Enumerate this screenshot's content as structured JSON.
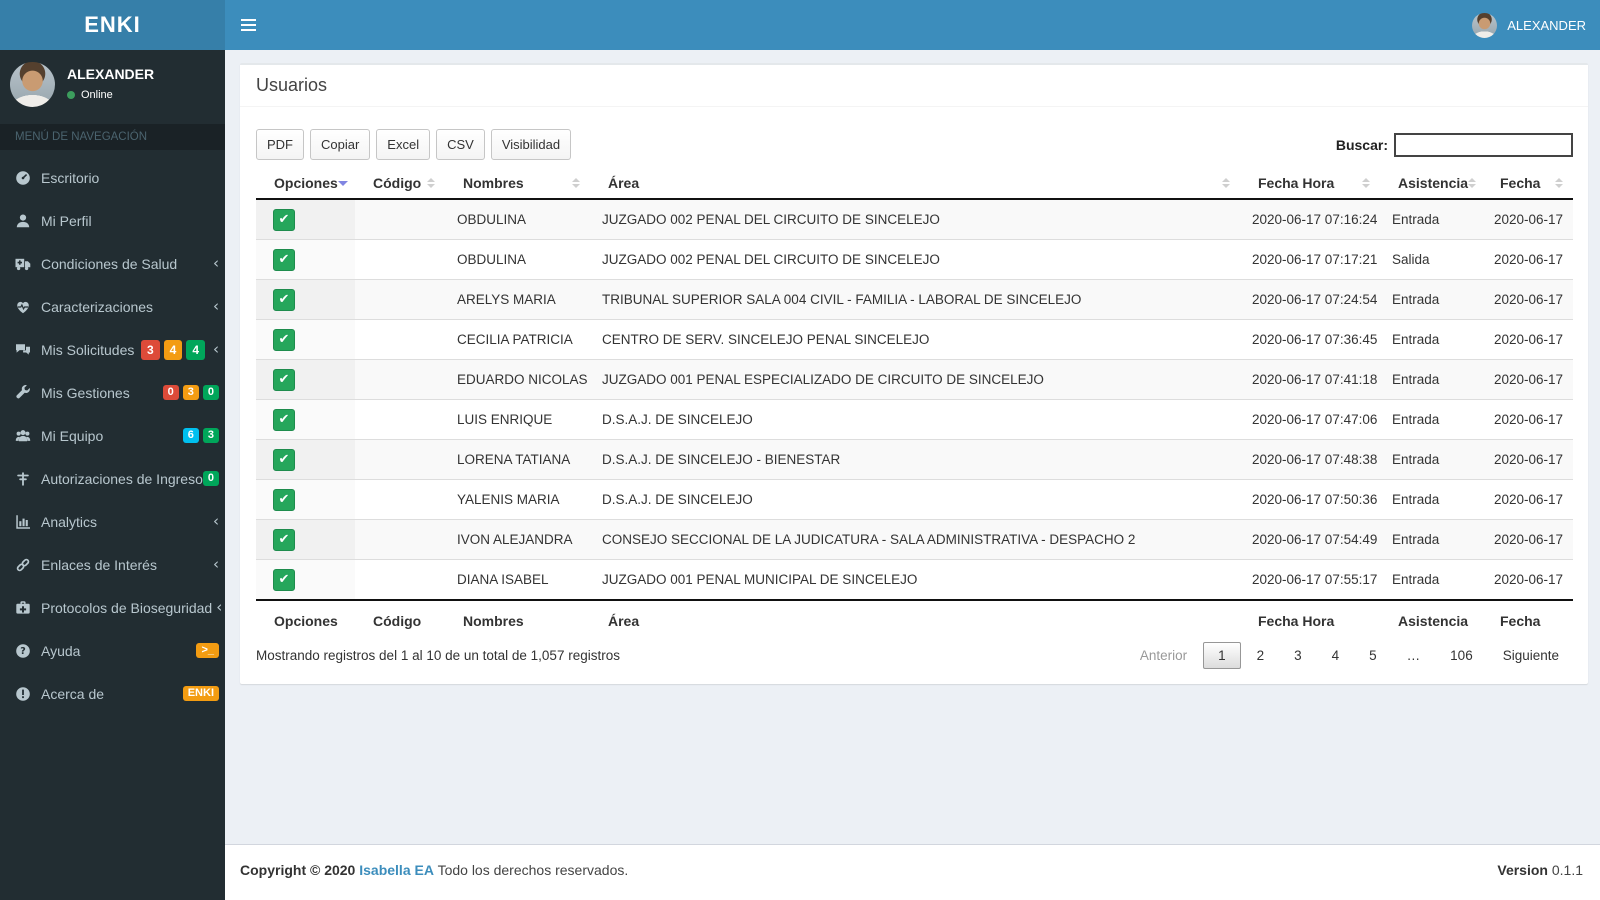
{
  "brand": "ENKI",
  "header": {
    "user_name": "ALEXANDER"
  },
  "sidebar": {
    "user": {
      "name": "ALEXANDER",
      "status": "Online"
    },
    "menu_header": "MENÚ DE NAVEGACIÓN",
    "items": [
      {
        "label": "Escritorio",
        "icon": "dashboard-icon",
        "badges": [],
        "has_submenu": false
      },
      {
        "label": "Mi Perfil",
        "icon": "user-icon",
        "badges": [],
        "has_submenu": false
      },
      {
        "label": "Condiciones de Salud",
        "icon": "ambulance-icon",
        "badges": [],
        "has_submenu": true
      },
      {
        "label": "Caracterizaciones",
        "icon": "heartbeat-icon",
        "badges": [],
        "has_submenu": true
      },
      {
        "label": "Mis Solicitudes",
        "icon": "comments-icon",
        "badges": [
          {
            "text": "3",
            "color": "#dd4b39"
          },
          {
            "text": "4",
            "color": "#f39c12"
          },
          {
            "text": "4",
            "color": "#00a65a"
          }
        ],
        "badge_size": "lg",
        "has_submenu": true
      },
      {
        "label": "Mis Gestiones",
        "icon": "wrench-icon",
        "badges": [
          {
            "text": "0",
            "color": "#dd4b39"
          },
          {
            "text": "3",
            "color": "#f39c12"
          },
          {
            "text": "0",
            "color": "#00a65a"
          }
        ],
        "has_submenu": false
      },
      {
        "label": "Mi Equipo",
        "icon": "users-icon",
        "badges": [
          {
            "text": "6",
            "color": "#00c0ef"
          },
          {
            "text": "3",
            "color": "#00a65a"
          }
        ],
        "has_submenu": false
      },
      {
        "label": "Autorizaciones de Ingreso",
        "icon": "signpost-icon",
        "badges": [
          {
            "text": "0",
            "color": "#00a65a"
          }
        ],
        "has_submenu": false
      },
      {
        "label": "Analytics",
        "icon": "bar-chart-icon",
        "badges": [],
        "has_submenu": true
      },
      {
        "label": "Enlaces de Interés",
        "icon": "link-icon",
        "badges": [],
        "has_submenu": true
      },
      {
        "label": "Protocolos de Bioseguridad",
        "icon": "medkit-icon",
        "badges": [],
        "has_submenu": true
      },
      {
        "label": "Ayuda",
        "icon": "question-icon",
        "badges": [
          {
            "text": ">_",
            "color": "#f39c12"
          }
        ],
        "has_submenu": false
      },
      {
        "label": "Acerca de",
        "icon": "info-icon",
        "badges": [
          {
            "text": "ENKI",
            "color": "#f39c12"
          }
        ],
        "has_submenu": false
      }
    ]
  },
  "page": {
    "title": "Usuarios"
  },
  "toolbar": {
    "buttons": [
      "PDF",
      "Copiar",
      "Excel",
      "CSV",
      "Visibilidad"
    ],
    "search_label": "Buscar:",
    "search_value": ""
  },
  "table": {
    "columns": [
      "Opciones",
      "Código",
      "Nombres",
      "Área",
      "Fecha Hora",
      "Asistencia",
      "Fecha"
    ],
    "sorted_column": "Opciones",
    "rows": [
      {
        "codigo": "",
        "nombres": "OBDULINA",
        "area": "JUZGADO 002 PENAL DEL CIRCUITO DE SINCELEJO",
        "fecha_hora": "2020-06-17 07:16:24",
        "asistencia": "Entrada",
        "fecha": "2020-06-17"
      },
      {
        "codigo": "",
        "nombres": "OBDULINA",
        "area": "JUZGADO 002 PENAL DEL CIRCUITO DE SINCELEJO",
        "fecha_hora": "2020-06-17 07:17:21",
        "asistencia": "Salida",
        "fecha": "2020-06-17"
      },
      {
        "codigo": "",
        "nombres": "ARELYS MARIA",
        "area": "TRIBUNAL SUPERIOR SALA 004 CIVIL - FAMILIA - LABORAL DE SINCELEJO",
        "fecha_hora": "2020-06-17 07:24:54",
        "asistencia": "Entrada",
        "fecha": "2020-06-17"
      },
      {
        "codigo": "",
        "nombres": "CECILIA PATRICIA",
        "area": "CENTRO DE SERV. SINCELEJO PENAL SINCELEJO",
        "fecha_hora": "2020-06-17 07:36:45",
        "asistencia": "Entrada",
        "fecha": "2020-06-17"
      },
      {
        "codigo": "",
        "nombres": "EDUARDO NICOLAS",
        "area": "JUZGADO 001 PENAL ESPECIALIZADO DE CIRCUITO DE SINCELEJO",
        "fecha_hora": "2020-06-17 07:41:18",
        "asistencia": "Entrada",
        "fecha": "2020-06-17"
      },
      {
        "codigo": "",
        "nombres": "LUIS ENRIQUE",
        "area": "D.S.A.J. DE SINCELEJO",
        "fecha_hora": "2020-06-17 07:47:06",
        "asistencia": "Entrada",
        "fecha": "2020-06-17"
      },
      {
        "codigo": "",
        "nombres": "LORENA TATIANA",
        "area": "D.S.A.J. DE SINCELEJO - BIENESTAR",
        "fecha_hora": "2020-06-17 07:48:38",
        "asistencia": "Entrada",
        "fecha": "2020-06-17"
      },
      {
        "codigo": "",
        "nombres": "YALENIS MARIA",
        "area": "D.S.A.J. DE SINCELEJO",
        "fecha_hora": "2020-06-17 07:50:36",
        "asistencia": "Entrada",
        "fecha": "2020-06-17"
      },
      {
        "codigo": "",
        "nombres": "IVON ALEJANDRA",
        "area": "CONSEJO SECCIONAL DE LA JUDICATURA - SALA ADMINISTRATIVA - DESPACHO 2",
        "fecha_hora": "2020-06-17 07:54:49",
        "asistencia": "Entrada",
        "fecha": "2020-06-17"
      },
      {
        "codigo": "",
        "nombres": "DIANA ISABEL",
        "area": "JUZGADO 001 PENAL MUNICIPAL DE SINCELEJO",
        "fecha_hora": "2020-06-17 07:55:17",
        "asistencia": "Entrada",
        "fecha": "2020-06-17"
      }
    ],
    "info": "Mostrando registros del 1 al 10 de un total de 1,057 registros",
    "pagination": {
      "previous": "Anterior",
      "pages": [
        "1",
        "2",
        "3",
        "4",
        "5",
        "…",
        "106"
      ],
      "active_page": "1",
      "next": "Siguiente"
    }
  },
  "footer": {
    "copyright_prefix": "Copyright © 2020",
    "brand_link": "Isabella EA",
    "copyright_suffix": "Todo los derechos reservados.",
    "version_label": "Version",
    "version_value": "0.1.1"
  }
}
